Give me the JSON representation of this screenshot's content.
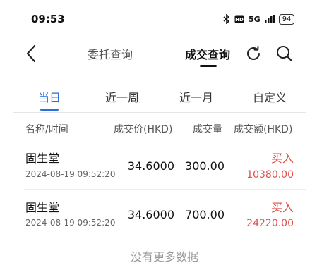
{
  "status_bar": {
    "time": "09:53",
    "network": "5G",
    "battery": "94"
  },
  "header": {
    "tab_inactive": "委托查询",
    "tab_active": "成交查询"
  },
  "periods": [
    "当日",
    "近一周",
    "近一月",
    "自定义"
  ],
  "columns": {
    "name_time": "名称/时间",
    "price": "成交价(HKD)",
    "qty": "成交量",
    "amount": "成交额(HKD)"
  },
  "rows": [
    {
      "name": "固生堂",
      "datetime": "2024-08-19 09:52:20",
      "price": "34.6000",
      "qty": "300.00",
      "side": "买入",
      "amount": "10380.00"
    },
    {
      "name": "固生堂",
      "datetime": "2024-08-19 09:52:20",
      "price": "34.6000",
      "qty": "700.00",
      "side": "买入",
      "amount": "24220.00"
    }
  ],
  "footer": {
    "no_more": "没有更多数据"
  },
  "colors": {
    "accent": "#2a6fd6",
    "buy": "#e0504b"
  }
}
